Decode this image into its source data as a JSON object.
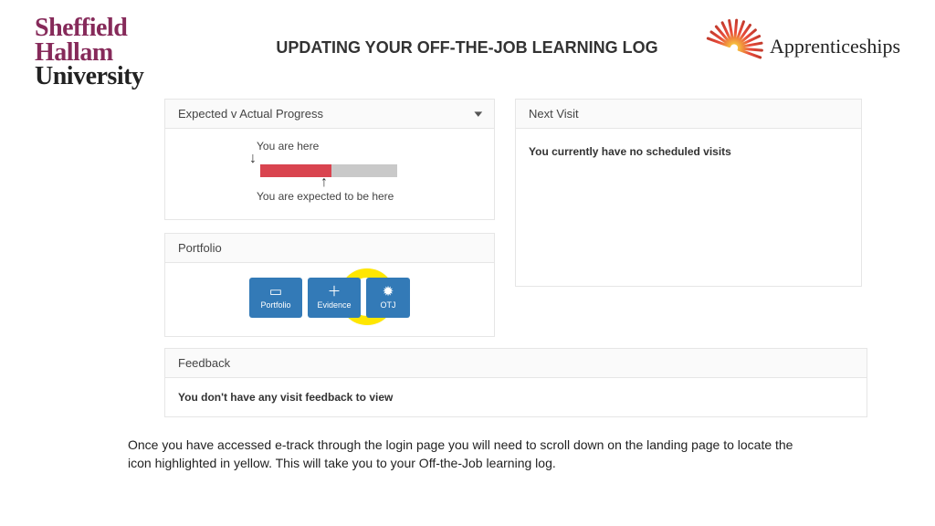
{
  "header": {
    "logo_shu_line1": "Sheffield",
    "logo_shu_line2": "Hallam",
    "logo_shu_line3": "University",
    "title": "UPDATING YOUR OFF-THE-JOB LEARNING LOG",
    "apprenticeships_brand": "Apprenticeships"
  },
  "progress_panel": {
    "title": "Expected v Actual Progress",
    "you_are_here": "You are here",
    "expected_here": "You are expected to be here",
    "actual_percent": 52,
    "expected_percent": 50
  },
  "next_visit_panel": {
    "title": "Next Visit",
    "message": "You currently have no scheduled visits"
  },
  "portfolio_panel": {
    "title": "Portfolio",
    "buttons": [
      {
        "icon": "book-icon",
        "label": "Portfolio"
      },
      {
        "icon": "plus-icon",
        "label": "Evidence"
      },
      {
        "icon": "gear-icon",
        "label": "OTJ"
      }
    ]
  },
  "feedback_panel": {
    "title": "Feedback",
    "message": "You don't have any visit feedback to view"
  },
  "caption": "Once you have accessed e-track through the login page you will need to scroll down on the landing page to locate the icon highlighted in yellow. This will take you to your Off-the-Job learning log."
}
